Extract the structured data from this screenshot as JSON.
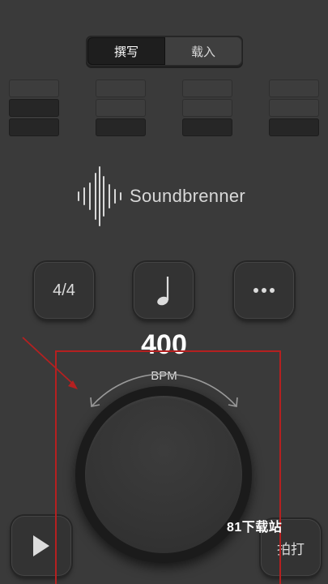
{
  "mode_tabs": {
    "compose": "撰写",
    "load": "载入"
  },
  "logo": {
    "brand": "Soundbrenner"
  },
  "controls": {
    "time_signature": "4/4",
    "note_icon": "quarter-note-icon",
    "more_icon": "more-dots-icon"
  },
  "tempo": {
    "value": "400",
    "unit": "BPM"
  },
  "bottom": {
    "play_icon": "play-icon",
    "tap_label": "拍打"
  },
  "watermark": "81下载站",
  "beats": [
    [
      "off",
      "on",
      "on"
    ],
    [
      "off",
      "off",
      "on"
    ],
    [
      "off",
      "off",
      "on"
    ],
    [
      "off",
      "off",
      "on"
    ]
  ],
  "colors": {
    "background": "#3a3a3a",
    "annotation": "#b52020"
  }
}
